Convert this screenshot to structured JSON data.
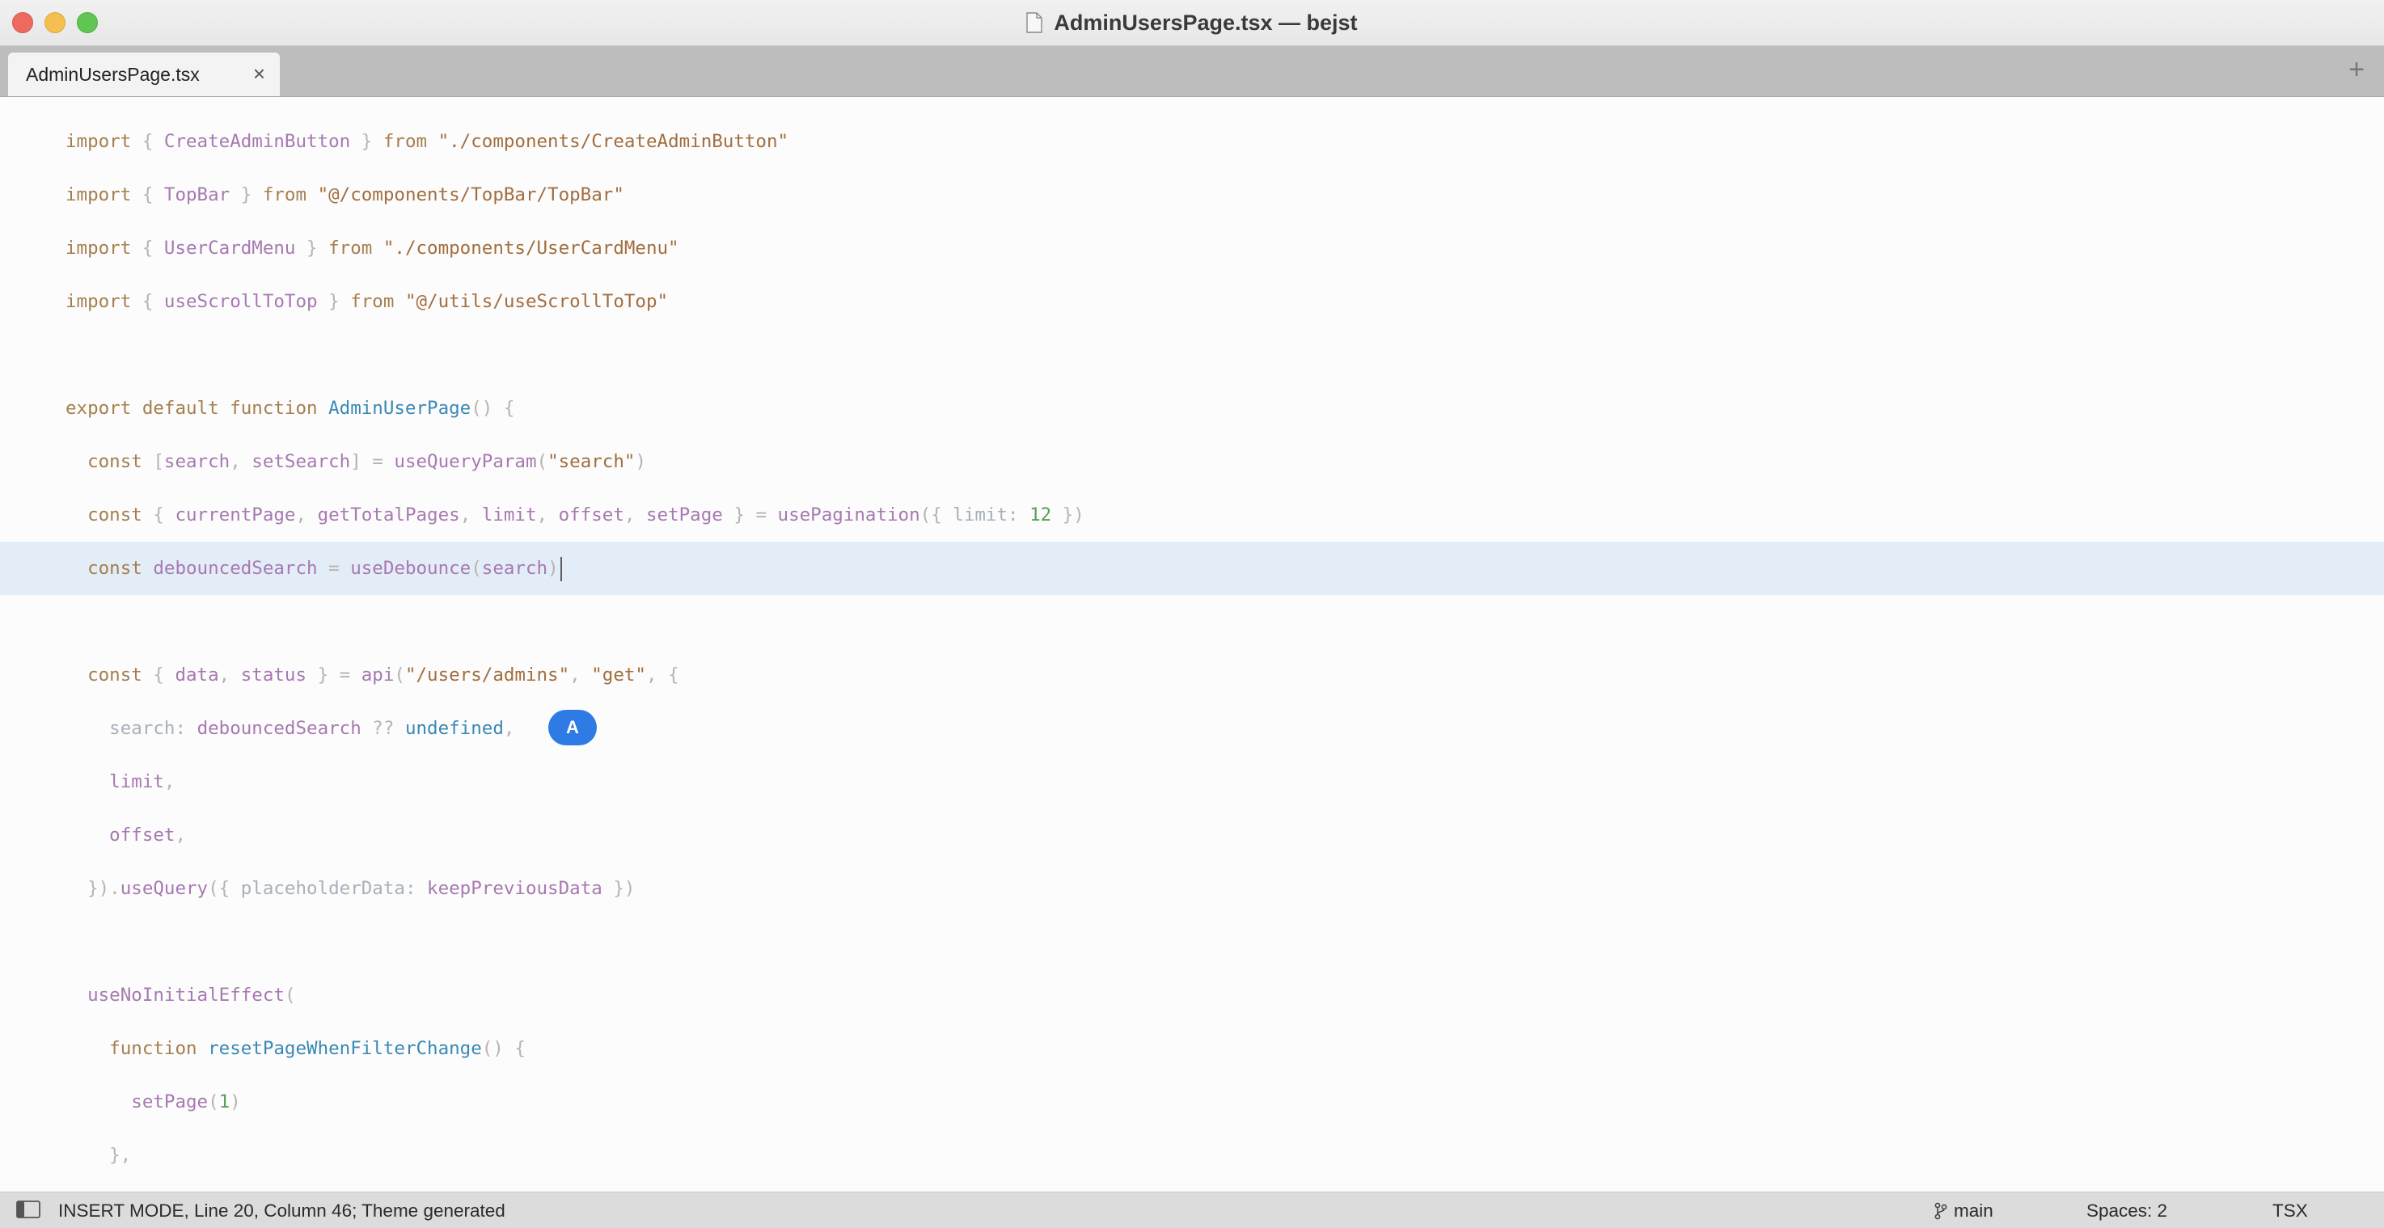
{
  "window": {
    "title": "AdminUsersPage.tsx — bejst"
  },
  "tabs": [
    {
      "label": "AdminUsersPage.tsx",
      "close": "×"
    }
  ],
  "tabbar": {
    "add": "+"
  },
  "editor": {
    "lines": [
      [
        [
          "kw",
          "import "
        ],
        [
          "punc",
          "{ "
        ],
        [
          "id",
          "CreateAdminButton"
        ],
        [
          "punc",
          " } "
        ],
        [
          "kw",
          "from "
        ],
        [
          "str",
          "\"./components/CreateAdminButton\""
        ]
      ],
      [
        [
          "kw",
          "import "
        ],
        [
          "punc",
          "{ "
        ],
        [
          "id",
          "TopBar"
        ],
        [
          "punc",
          " } "
        ],
        [
          "kw",
          "from "
        ],
        [
          "str",
          "\"@/components/TopBar/TopBar\""
        ]
      ],
      [
        [
          "kw",
          "import "
        ],
        [
          "punc",
          "{ "
        ],
        [
          "id",
          "UserCardMenu"
        ],
        [
          "punc",
          " } "
        ],
        [
          "kw",
          "from "
        ],
        [
          "str",
          "\"./components/UserCardMenu\""
        ]
      ],
      [
        [
          "kw",
          "import "
        ],
        [
          "punc",
          "{ "
        ],
        [
          "id",
          "useScrollToTop"
        ],
        [
          "punc",
          " } "
        ],
        [
          "kw",
          "from "
        ],
        [
          "str",
          "\"@/utils/useScrollToTop\""
        ]
      ],
      [],
      [
        [
          "kw",
          "export default function "
        ],
        [
          "fn",
          "AdminUserPage"
        ],
        [
          "punc",
          "() {"
        ]
      ],
      [
        [
          "kw",
          "  const "
        ],
        [
          "punc",
          "["
        ],
        [
          "id",
          "search"
        ],
        [
          "punc",
          ", "
        ],
        [
          "id",
          "setSearch"
        ],
        [
          "punc",
          "] = "
        ],
        [
          "id",
          "useQueryParam"
        ],
        [
          "punc",
          "("
        ],
        [
          "str",
          "\"search\""
        ],
        [
          "punc",
          ")"
        ]
      ],
      [
        [
          "kw",
          "  const "
        ],
        [
          "punc",
          "{ "
        ],
        [
          "id",
          "currentPage"
        ],
        [
          "punc",
          ", "
        ],
        [
          "id",
          "getTotalPages"
        ],
        [
          "punc",
          ", "
        ],
        [
          "id",
          "limit"
        ],
        [
          "punc",
          ", "
        ],
        [
          "id",
          "offset"
        ],
        [
          "punc",
          ", "
        ],
        [
          "id",
          "setPage"
        ],
        [
          "punc",
          " } = "
        ],
        [
          "id",
          "usePagination"
        ],
        [
          "punc",
          "({ "
        ],
        [
          "prop",
          "limit: "
        ],
        [
          "num",
          "12"
        ],
        [
          "punc",
          " })"
        ]
      ],
      [
        [
          "kw",
          "  const "
        ],
        [
          "id",
          "debouncedSearch"
        ],
        [
          "punc",
          " = "
        ],
        [
          "id",
          "useDebounce"
        ],
        [
          "punc",
          "("
        ],
        [
          "id",
          "search"
        ],
        [
          "punc",
          ")"
        ]
      ],
      [],
      [
        [
          "kw",
          "  const "
        ],
        [
          "punc",
          "{ "
        ],
        [
          "id",
          "data"
        ],
        [
          "punc",
          ", "
        ],
        [
          "id",
          "status"
        ],
        [
          "punc",
          " } = "
        ],
        [
          "id",
          "api"
        ],
        [
          "punc",
          "("
        ],
        [
          "str",
          "\"/users/admins\""
        ],
        [
          "punc",
          ", "
        ],
        [
          "str",
          "\"get\""
        ],
        [
          "punc",
          ", {"
        ]
      ],
      [
        [
          "prop",
          "    search: "
        ],
        [
          "id",
          "debouncedSearch"
        ],
        [
          "punc",
          " ?? "
        ],
        [
          "fn",
          "undefined"
        ],
        [
          "punc",
          ","
        ]
      ],
      [
        [
          "id",
          "    limit"
        ],
        [
          "punc",
          ","
        ]
      ],
      [
        [
          "id",
          "    offset"
        ],
        [
          "punc",
          ","
        ]
      ],
      [
        [
          "punc",
          "  })."
        ],
        [
          "id",
          "useQuery"
        ],
        [
          "punc",
          "({ "
        ],
        [
          "prop",
          "placeholderData: "
        ],
        [
          "id",
          "keepPreviousData"
        ],
        [
          "punc",
          " })"
        ]
      ],
      [],
      [
        [
          "id",
          "  useNoInitialEffect"
        ],
        [
          "punc",
          "("
        ]
      ],
      [
        [
          "kw",
          "    function "
        ],
        [
          "fn",
          "resetPageWhenFilterChange"
        ],
        [
          "punc",
          "() {"
        ]
      ],
      [
        [
          "id",
          "      setPage"
        ],
        [
          "punc",
          "("
        ],
        [
          "num",
          "1"
        ],
        [
          "punc",
          ")"
        ]
      ],
      [
        [
          "punc",
          "    },"
        ]
      ]
    ],
    "current_line_index": 8,
    "collaborator_badge": "A"
  },
  "statusbar": {
    "status": "INSERT MODE, Line 20, Column 46; Theme generated",
    "branch": "main",
    "spaces": "Spaces: 2",
    "syntax": "TSX"
  },
  "icons": {
    "title": "file-icon",
    "sidebar_toggle": "sidebar-toggle-icon",
    "branch": "git-branch-icon"
  }
}
